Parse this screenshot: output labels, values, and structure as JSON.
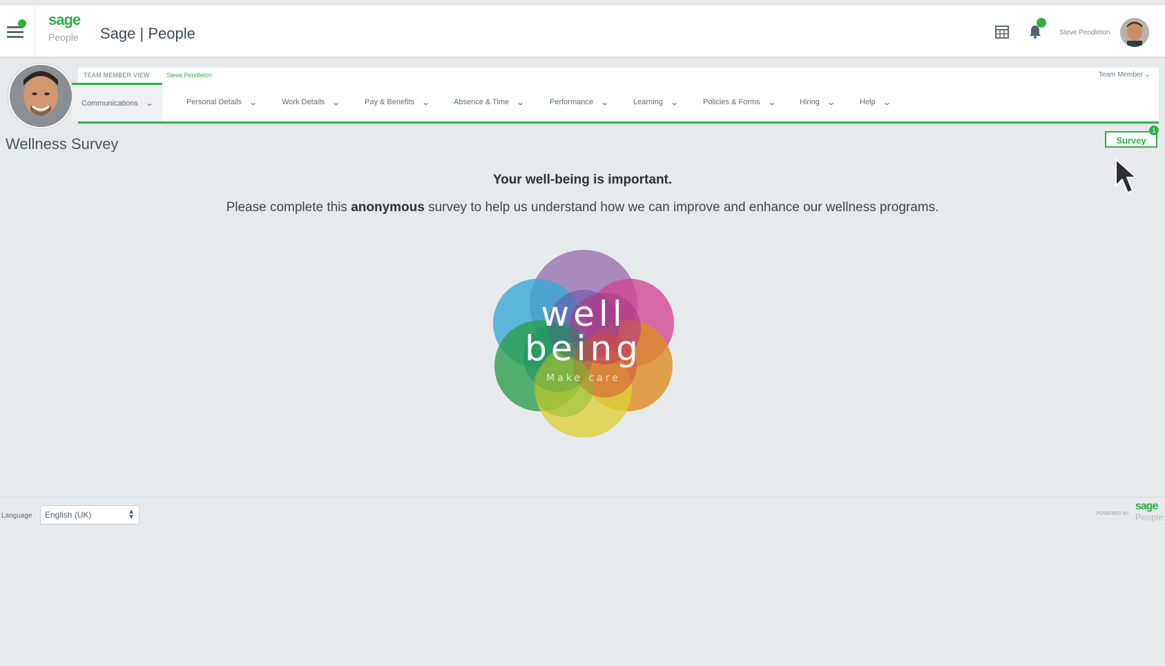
{
  "topbar": {
    "logo_sage": "sage",
    "logo_people": "People",
    "title": "Sage | People",
    "user_name": "Steve Pendleton",
    "icons": [
      "menu-icon",
      "calendar-icon",
      "bell-icon"
    ]
  },
  "team": {
    "view_label": "TEAM MEMBER VIEW",
    "person": "Steve Pendleton",
    "role": "Team Member"
  },
  "nav": {
    "items": [
      {
        "label": "Communications"
      },
      {
        "label": "Personal Details"
      },
      {
        "label": "Work Details"
      },
      {
        "label": "Pay & Benefits"
      },
      {
        "label": "Absence & Time"
      },
      {
        "label": "Performance"
      },
      {
        "label": "Learning"
      },
      {
        "label": "Policies & Forms"
      },
      {
        "label": "Hiring"
      },
      {
        "label": "Help"
      }
    ],
    "chevron": "⌄"
  },
  "page": {
    "title": "Wellness Survey",
    "survey_button": "Survey",
    "survey_badge": "1",
    "headline": "Your well-being is important.",
    "sub_before": "Please complete this ",
    "sub_bold": "anonymous",
    "sub_after": " survey to help us understand how we can improve and enhance our wellness programs."
  },
  "logo_art": {
    "word1": "well",
    "word2": "being",
    "tagline": "Make care"
  },
  "footer": {
    "language_label": "Language",
    "language_value": "English (UK)",
    "powered_by": "POWERED BY",
    "logo_sage": "sage",
    "logo_people": "People"
  },
  "colors": {
    "accent": "#2fae4a",
    "background": "#e7eaec"
  }
}
